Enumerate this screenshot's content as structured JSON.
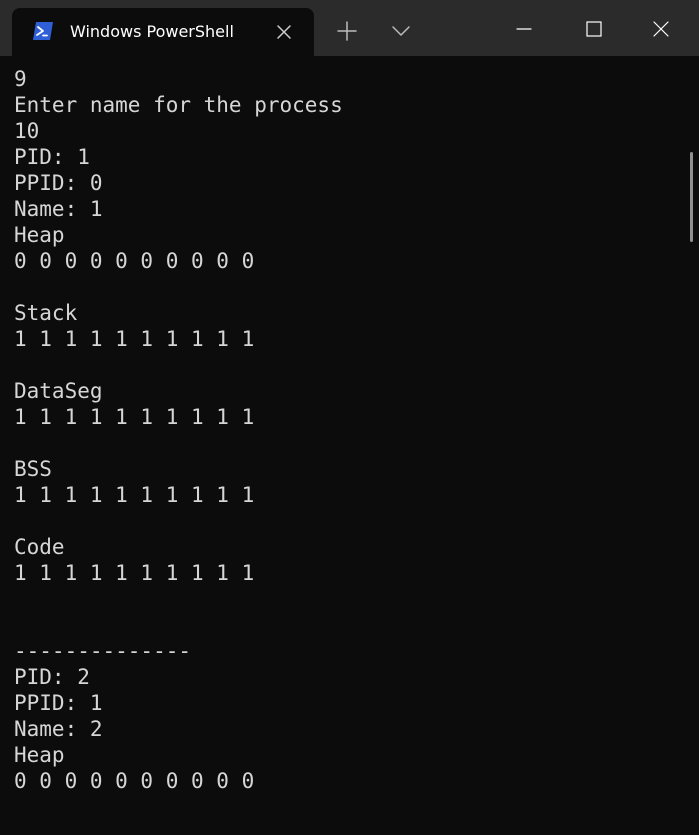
{
  "window": {
    "tab_title": "Windows PowerShell"
  },
  "icons": {
    "tab_icon": "powershell-icon",
    "tab_close": "close-icon",
    "new_tab": "plus-icon",
    "dropdown": "chevron-down-icon",
    "minimize": "minimize-icon",
    "maximize": "maximize-icon",
    "close": "close-icon"
  },
  "colors": {
    "background": "#0c0c0c",
    "titlebar": "#2b2b2b",
    "text": "#d6d6d6",
    "powershell_icon": "#2f5fd6"
  },
  "terminal": {
    "lines": [
      "9",
      "Enter name for the process",
      "10",
      "PID: 1",
      "PPID: 0",
      "Name: 1",
      "Heap",
      "0 0 0 0 0 0 0 0 0 0",
      "",
      "Stack",
      "1 1 1 1 1 1 1 1 1 1",
      "",
      "DataSeg",
      "1 1 1 1 1 1 1 1 1 1",
      "",
      "BSS",
      "1 1 1 1 1 1 1 1 1 1",
      "",
      "Code",
      "1 1 1 1 1 1 1 1 1 1",
      "",
      "",
      "--------------",
      "PID: 2",
      "PPID: 1",
      "Name: 2",
      "Heap",
      "0 0 0 0 0 0 0 0 0 0"
    ]
  }
}
